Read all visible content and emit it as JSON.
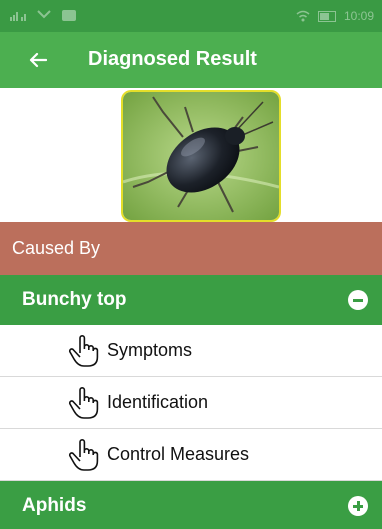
{
  "status_bar": {
    "time": "10:09"
  },
  "app_bar": {
    "title": "Diagnosed Result",
    "back_icon": "arrow-left-icon"
  },
  "caused_by": {
    "label": "Caused By"
  },
  "groups": [
    {
      "title": "Bunchy top",
      "expanded": true,
      "items": [
        {
          "label": "Symptoms",
          "icon": "hand-pointer-icon"
        },
        {
          "label": "Identification",
          "icon": "hand-pointer-icon"
        },
        {
          "label": "Control Measures",
          "icon": "hand-pointer-icon"
        }
      ]
    },
    {
      "title": "Aphids",
      "expanded": false,
      "items": []
    }
  ],
  "colors": {
    "status_bar": "#3a9a44",
    "app_bar": "#4caf50",
    "caused_by_bg": "#bb6f5c",
    "group_header": "#3a9e44",
    "image_border": "#e4de2a"
  }
}
